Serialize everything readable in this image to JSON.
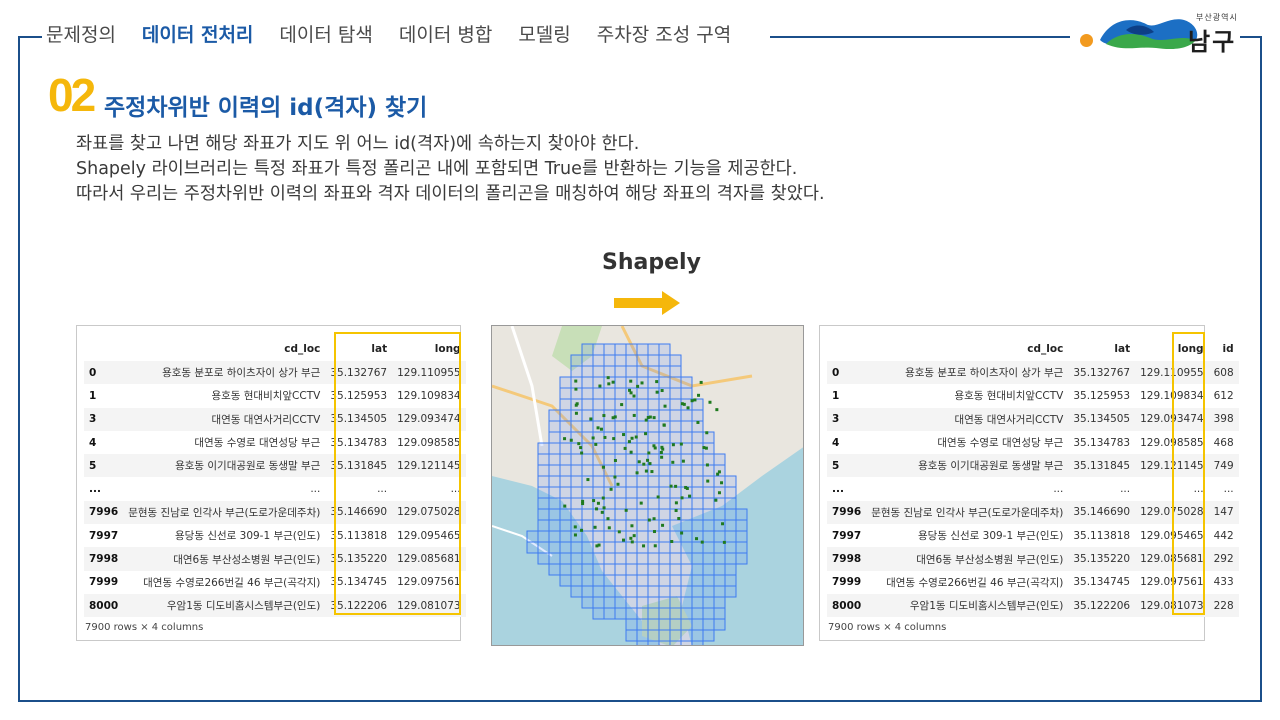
{
  "nav": {
    "items": [
      "문제정의",
      "데이터 전처리",
      "데이터 탐색",
      "데이터 병합",
      "모델링",
      "주차장 조성 구역"
    ],
    "active_index": 1
  },
  "logo": {
    "city": "부산광역시",
    "name": "남구"
  },
  "section": {
    "number": "02",
    "title": "주정차위반 이력의 id(격자) 찾기"
  },
  "description": [
    "좌표를 찾고 나면 해당 좌표가 지도 위 어느 id(격자)에 속하는지 찾아야 한다.",
    "Shapely 라이브러리는 특정 좌표가 특정 폴리곤 내에 포함되면 True를 반환하는 기능을 제공한다.",
    "따라서 우리는 주정차위반 이력의 좌표와 격자 데이터의 폴리곤을 매칭하여 해당 좌표의 격자를 찾았다."
  ],
  "process_label": "Shapely",
  "colors": {
    "accent": "#1b5aa6",
    "highlight": "#f5c400",
    "arrow": "#f5b70b",
    "frame": "#1b4f8a"
  },
  "left_table": {
    "columns": [
      "",
      "cd_loc",
      "lat",
      "long"
    ],
    "rows": [
      [
        "0",
        "용호동 분포로 하이츠자이 상가 부근",
        "35.132767",
        "129.110955"
      ],
      [
        "1",
        "용호동 현대비치앞CCTV",
        "35.125953",
        "129.109834"
      ],
      [
        "3",
        "대연동 대연사거리CCTV",
        "35.134505",
        "129.093474"
      ],
      [
        "4",
        "대연동 수영로 대연성당 부근",
        "35.134783",
        "129.098585"
      ],
      [
        "5",
        "용호동 이기대공원로 동생말 부근",
        "35.131845",
        "129.121145"
      ],
      [
        "...",
        "...",
        "...",
        "..."
      ],
      [
        "7996",
        "문현동 진남로 인각사 부근(도로가운데주차)",
        "35.146690",
        "129.075028"
      ],
      [
        "7997",
        "용당동 신선로 309-1 부근(인도)",
        "35.113818",
        "129.095465"
      ],
      [
        "7998",
        "대연6동 부산성소병원 부근(인도)",
        "35.135220",
        "129.085681"
      ],
      [
        "7999",
        "대연동 수영로266번길 46 부근(곡각지)",
        "35.134745",
        "129.097561"
      ],
      [
        "8000",
        "우암1동 디도비홈시스템부근(인도)",
        "35.122206",
        "129.081073"
      ]
    ],
    "caption": "7900 rows × 4 columns"
  },
  "right_table": {
    "columns": [
      "",
      "cd_loc",
      "lat",
      "long",
      "id"
    ],
    "rows": [
      [
        "0",
        "용호동 분포로 하이츠자이 상가 부근",
        "35.132767",
        "129.110955",
        "608"
      ],
      [
        "1",
        "용호동 현대비치앞CCTV",
        "35.125953",
        "129.109834",
        "612"
      ],
      [
        "3",
        "대연동 대연사거리CCTV",
        "35.134505",
        "129.093474",
        "398"
      ],
      [
        "4",
        "대연동 수영로 대연성당 부근",
        "35.134783",
        "129.098585",
        "468"
      ],
      [
        "5",
        "용호동 이기대공원로 동생말 부근",
        "35.131845",
        "129.121145",
        "749"
      ],
      [
        "...",
        "...",
        "...",
        "...",
        "..."
      ],
      [
        "7996",
        "문현동 진남로 인각사 부근(도로가운데주차)",
        "35.146690",
        "129.075028",
        "147"
      ],
      [
        "7997",
        "용당동 신선로 309-1 부근(인도)",
        "35.113818",
        "129.095465",
        "442"
      ],
      [
        "7998",
        "대연6동 부산성소병원 부근(인도)",
        "35.135220",
        "129.085681",
        "292"
      ],
      [
        "7999",
        "대연동 수영로266번길 46 부근(곡각지)",
        "35.134745",
        "129.097561",
        "433"
      ],
      [
        "8000",
        "우암1동 디도비홈시스템부근(인도)",
        "35.122206",
        "129.081073",
        "228"
      ]
    ],
    "caption": "7900 rows × 4 columns"
  }
}
